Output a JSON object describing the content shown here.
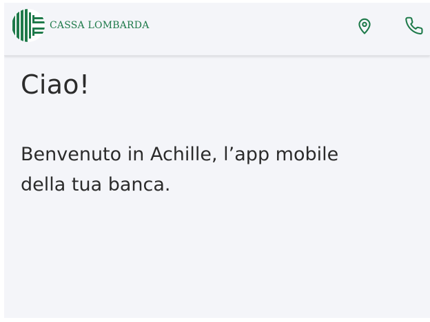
{
  "header": {
    "brand_name": "CASSA LOMBARDA",
    "logo_icon": "cassa-lombarda-logo",
    "location_icon": "location-pin-icon",
    "phone_icon": "phone-icon"
  },
  "main": {
    "greeting": "Ciao!",
    "welcome_line1": "Benvenuto in Achille, l’app mobile",
    "welcome_line2": "della tua banca."
  },
  "colors": {
    "brand_green": "#1e7a4a",
    "background": "#f4f5f9",
    "text": "#2b2b2b"
  }
}
